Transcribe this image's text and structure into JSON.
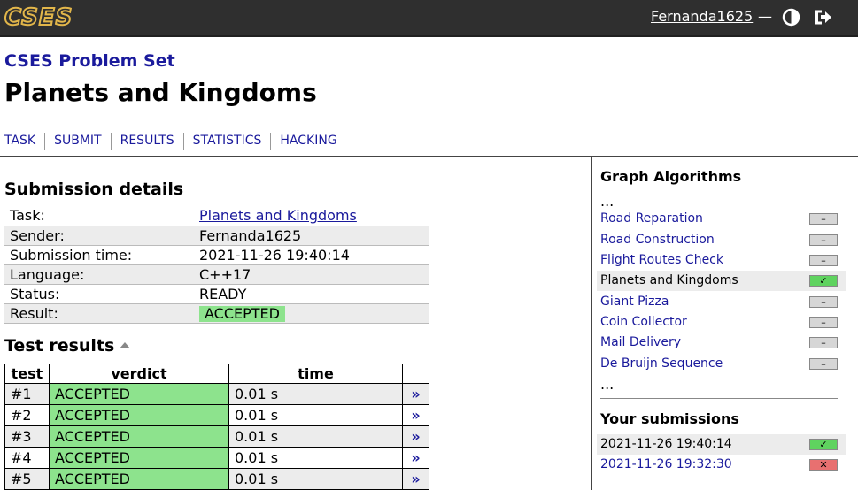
{
  "header": {
    "logo": "CSES",
    "username": "Fernanda1625",
    "separator": "—"
  },
  "page": {
    "problem_set": "CSES Problem Set",
    "task_title": "Planets and Kingdoms"
  },
  "nav": [
    "TASK",
    "SUBMIT",
    "RESULTS",
    "STATISTICS",
    "HACKING"
  ],
  "details": {
    "heading": "Submission details",
    "rows": [
      {
        "key": "Task:",
        "value": "Planets and Kingdoms"
      },
      {
        "key": "Sender:",
        "value": "Fernanda1625"
      },
      {
        "key": "Submission time:",
        "value": "2021-11-26 19:40:14"
      },
      {
        "key": "Language:",
        "value": "C++17"
      },
      {
        "key": "Status:",
        "value": "READY"
      },
      {
        "key": "Result:",
        "value": "ACCEPTED"
      }
    ]
  },
  "tests": {
    "heading": "Test results",
    "columns": [
      "test",
      "verdict",
      "time",
      ""
    ],
    "rows": [
      {
        "test": "#1",
        "verdict": "ACCEPTED",
        "time": "0.01 s",
        "arrow": "»"
      },
      {
        "test": "#2",
        "verdict": "ACCEPTED",
        "time": "0.01 s",
        "arrow": "»"
      },
      {
        "test": "#3",
        "verdict": "ACCEPTED",
        "time": "0.01 s",
        "arrow": "»"
      },
      {
        "test": "#4",
        "verdict": "ACCEPTED",
        "time": "0.01 s",
        "arrow": "»"
      },
      {
        "test": "#5",
        "verdict": "ACCEPTED",
        "time": "0.01 s",
        "arrow": "»"
      }
    ]
  },
  "sidebar": {
    "section_title": "Graph Algorithms",
    "ellipsis": "...",
    "problems": [
      {
        "name": "Road Reparation",
        "mark": "–",
        "status": "none"
      },
      {
        "name": "Road Construction",
        "mark": "–",
        "status": "none"
      },
      {
        "name": "Flight Routes Check",
        "mark": "–",
        "status": "none"
      },
      {
        "name": "Planets and Kingdoms",
        "mark": "✓",
        "status": "solved"
      },
      {
        "name": "Giant Pizza",
        "mark": "–",
        "status": "none"
      },
      {
        "name": "Coin Collector",
        "mark": "–",
        "status": "none"
      },
      {
        "name": "Mail Delivery",
        "mark": "–",
        "status": "none"
      },
      {
        "name": "De Bruijn Sequence",
        "mark": "–",
        "status": "none"
      }
    ],
    "submissions_title": "Your submissions",
    "submissions": [
      {
        "time": "2021-11-26 19:40:14",
        "mark": "✓",
        "status": "accepted"
      },
      {
        "time": "2021-11-26 19:32:30",
        "mark": "✕",
        "status": "rejected"
      }
    ]
  },
  "colors": {
    "accepted": "#8de38d",
    "link": "#1a1a9c",
    "header_bg": "#2f2f2f",
    "logo": "#e2b64a"
  }
}
